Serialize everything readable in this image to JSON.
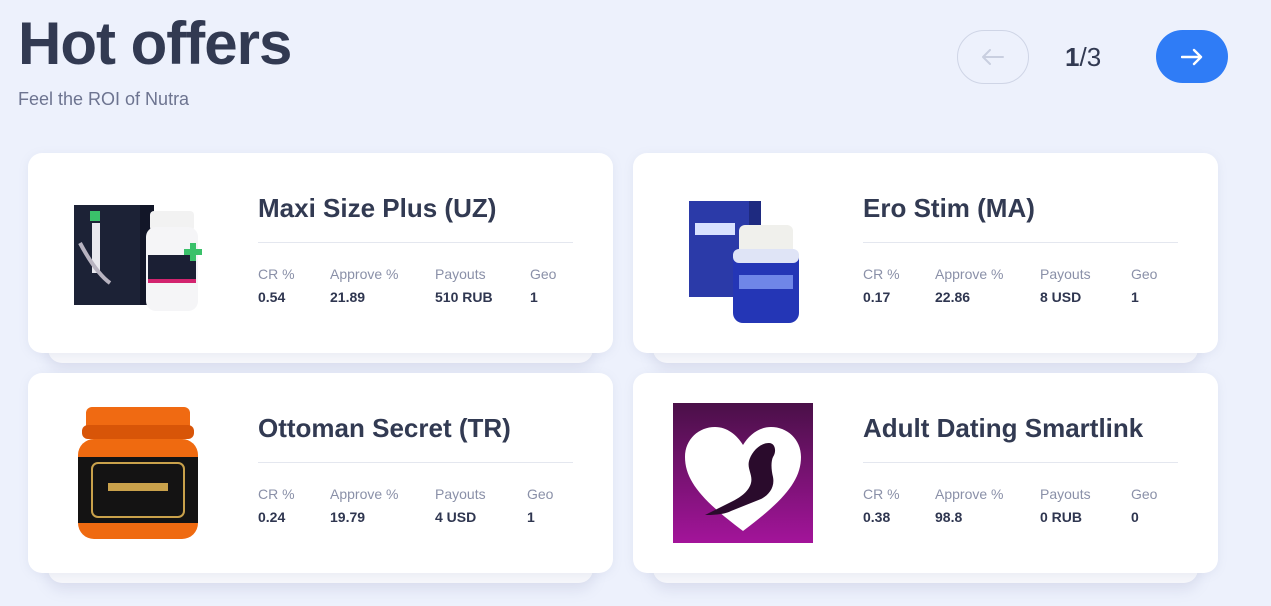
{
  "header": {
    "title": "Hot offers",
    "subtitle": "Feel the ROI of Nutra"
  },
  "pager": {
    "current": "1",
    "total": "/3",
    "prev_icon": "arrow-left-icon",
    "next_icon": "arrow-right-icon",
    "accent_color": "#2f7cf6"
  },
  "labels": {
    "cr": "CR %",
    "approve": "Approve %",
    "payouts": "Payouts",
    "geo": "Geo"
  },
  "offers": [
    {
      "name": "Maxi Size Plus (UZ)",
      "cr": "0.54",
      "approve": "21.89",
      "payouts": "510 RUB",
      "geo": "1",
      "image": "maxisize-product-image"
    },
    {
      "name": "Ero Stim (MA)",
      "cr": "0.17",
      "approve": "22.86",
      "payouts": "8 USD",
      "geo": "1",
      "image": "erostim-product-image"
    },
    {
      "name": "Ottoman Secret (TR)",
      "cr": "0.24",
      "approve": "19.79",
      "payouts": "4 USD",
      "geo": "1",
      "image": "ottoman-secret-jar-image"
    },
    {
      "name": "Adult Dating Smartlink",
      "cr": "0.38",
      "approve": "98.8",
      "payouts": "0 RUB",
      "geo": "0",
      "image": "heart-silhouette-image"
    }
  ]
}
